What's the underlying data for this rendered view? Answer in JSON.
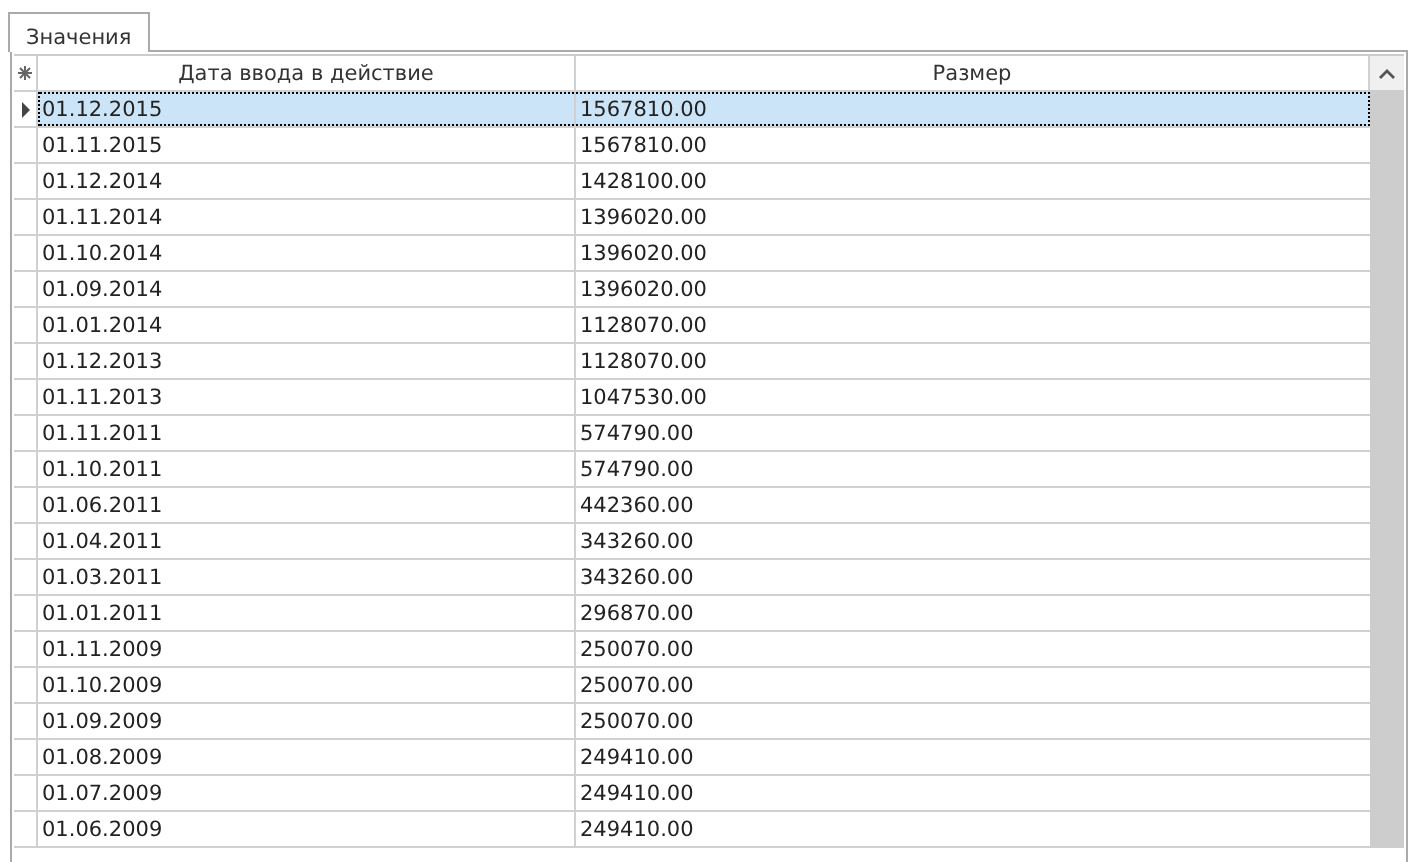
{
  "tabs": [
    {
      "label": "Значения",
      "selected": true
    }
  ],
  "table": {
    "columns": [
      "Дата ввода в действие",
      "Размер"
    ],
    "rows": [
      {
        "cells": [
          "01.12.2015",
          "1567810.00"
        ],
        "selected": true
      },
      {
        "cells": [
          "01.11.2015",
          "1567810.00"
        ],
        "selected": false
      },
      {
        "cells": [
          "01.12.2014",
          "1428100.00"
        ],
        "selected": false
      },
      {
        "cells": [
          "01.11.2014",
          "1396020.00"
        ],
        "selected": false
      },
      {
        "cells": [
          "01.10.2014",
          "1396020.00"
        ],
        "selected": false
      },
      {
        "cells": [
          "01.09.2014",
          "1396020.00"
        ],
        "selected": false
      },
      {
        "cells": [
          "01.01.2014",
          "1128070.00"
        ],
        "selected": false
      },
      {
        "cells": [
          "01.12.2013",
          "1128070.00"
        ],
        "selected": false
      },
      {
        "cells": [
          "01.11.2013",
          "1047530.00"
        ],
        "selected": false
      },
      {
        "cells": [
          "01.11.2011",
          "574790.00"
        ],
        "selected": false
      },
      {
        "cells": [
          "01.10.2011",
          "574790.00"
        ],
        "selected": false
      },
      {
        "cells": [
          "01.06.2011",
          "442360.00"
        ],
        "selected": false
      },
      {
        "cells": [
          "01.04.2011",
          "343260.00"
        ],
        "selected": false
      },
      {
        "cells": [
          "01.03.2011",
          "343260.00"
        ],
        "selected": false
      },
      {
        "cells": [
          "01.01.2011",
          "296870.00"
        ],
        "selected": false
      },
      {
        "cells": [
          "01.11.2009",
          "250070.00"
        ],
        "selected": false
      },
      {
        "cells": [
          "01.10.2009",
          "250070.00"
        ],
        "selected": false
      },
      {
        "cells": [
          "01.09.2009",
          "250070.00"
        ],
        "selected": false
      },
      {
        "cells": [
          "01.08.2009",
          "249410.00"
        ],
        "selected": false
      },
      {
        "cells": [
          "01.07.2009",
          "249410.00"
        ],
        "selected": false
      },
      {
        "cells": [
          "01.06.2009",
          "249410.00"
        ],
        "selected": false
      }
    ]
  }
}
